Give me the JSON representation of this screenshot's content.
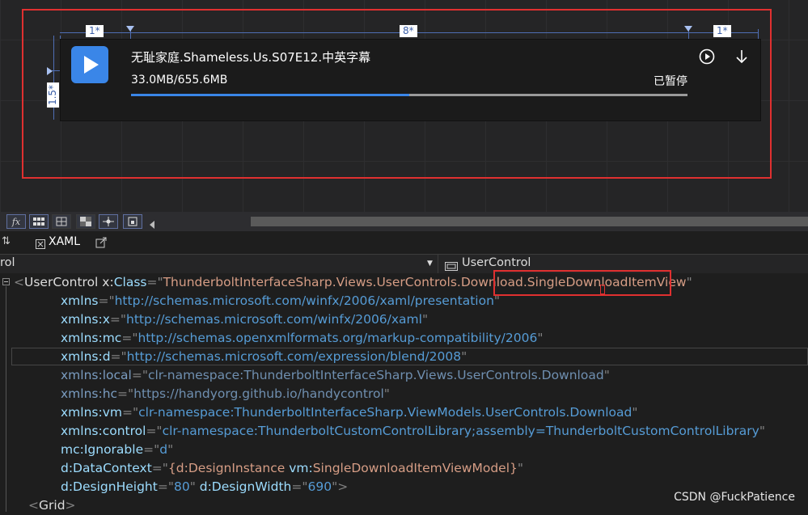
{
  "designer": {
    "col_labels": [
      "1*",
      "8*",
      "1*"
    ],
    "row_label": "1.5*",
    "item": {
      "filename": "无耻家庭.Shameless.Us.S07E12.中英字幕",
      "size": "33.0MB/655.6MB",
      "status": "已暂停",
      "progress": 0.5
    },
    "icons": [
      "play-icon",
      "play-circle-icon",
      "download-arrow-icon"
    ]
  },
  "toolbar": {
    "buttons": [
      "fx",
      "grid",
      "grid-alt",
      "checker",
      "snap",
      "lock"
    ]
  },
  "tabs": {
    "xaml": "XAML"
  },
  "navbar": {
    "left": "rol",
    "right": "UserControl"
  },
  "code": {
    "lines": [
      [
        [
          "<",
          "punct"
        ],
        [
          "UserControl",
          "tag"
        ],
        [
          " x:",
          "attrp"
        ],
        [
          "Class",
          "attr"
        ],
        [
          "=\"",
          "punct"
        ],
        [
          "ThunderboltInterfaceSharp.Views.UserControls.Download.SingleDownloadItemView",
          "val"
        ],
        [
          "\"",
          "punct"
        ]
      ],
      [
        [
          "xmlns",
          "attr"
        ],
        [
          "=\"",
          "punct"
        ],
        [
          "http://schemas.microsoft.com/winfx/2006/xaml/presentation",
          "str"
        ],
        [
          "\"",
          "punct"
        ]
      ],
      [
        [
          "xmlns:x",
          "attr"
        ],
        [
          "=\"",
          "punct"
        ],
        [
          "http://schemas.microsoft.com/winfx/2006/xaml",
          "str"
        ],
        [
          "\"",
          "punct"
        ]
      ],
      [
        [
          "xmlns:mc",
          "attr"
        ],
        [
          "=\"",
          "punct"
        ],
        [
          "http://schemas.openxmlformats.org/markup-compatibility/2006",
          "str"
        ],
        [
          "\"",
          "punct"
        ]
      ],
      [
        [
          "xmlns:d",
          "attr"
        ],
        [
          "=\"",
          "punct"
        ],
        [
          "http://schemas.microsoft.com/expression/blend/2008",
          "str"
        ],
        [
          "\"",
          "punct"
        ]
      ],
      [
        [
          "xmlns:local",
          "dimattr"
        ],
        [
          "=\"",
          "punct"
        ],
        [
          "clr-namespace:ThunderboltInterfaceSharp.Views.UserControls.Download",
          "dim"
        ],
        [
          "\"",
          "punct"
        ]
      ],
      [
        [
          "xmlns:hc",
          "dimattr"
        ],
        [
          "=\"",
          "punct"
        ],
        [
          "https://handyorg.github.io/handycontrol",
          "dim"
        ],
        [
          "\"",
          "punct"
        ]
      ],
      [
        [
          "xmlns:vm",
          "attr"
        ],
        [
          "=\"",
          "punct"
        ],
        [
          "clr-namespace:ThunderboltInterfaceSharp.ViewModels.UserControls.Download",
          "str"
        ],
        [
          "\"",
          "punct"
        ]
      ],
      [
        [
          "xmlns:control",
          "attr"
        ],
        [
          "=\"",
          "punct"
        ],
        [
          "clr-namespace:ThunderboltCustomControlLibrary;assembly=ThunderboltCustomControlLibrary",
          "str"
        ],
        [
          "\"",
          "punct"
        ]
      ],
      [
        [
          "mc:Ignorable",
          "attr"
        ],
        [
          "=\"",
          "punct"
        ],
        [
          "d",
          "str"
        ],
        [
          "\"",
          "punct"
        ]
      ],
      [
        [
          "d:DataContext",
          "attr"
        ],
        [
          "=\"",
          "punct"
        ],
        [
          "{d:DesignInstance ",
          "val"
        ],
        [
          "vm:",
          "attr"
        ],
        [
          "SingleDownloadItemViewModel",
          "val"
        ],
        [
          "}",
          "val"
        ],
        [
          "\"",
          "punct"
        ]
      ],
      [
        [
          "d:DesignHeight",
          "attr"
        ],
        [
          "=\"",
          "punct"
        ],
        [
          "80",
          "str"
        ],
        [
          "\" ",
          "punct"
        ],
        [
          "d:DesignWidth",
          "attr"
        ],
        [
          "=\"",
          "punct"
        ],
        [
          "690",
          "str"
        ],
        [
          "\">",
          "punct"
        ]
      ],
      [
        [
          "<",
          "punct"
        ],
        [
          "Grid",
          "tag"
        ],
        [
          ">",
          "punct"
        ]
      ]
    ]
  },
  "watermark": "CSDN @FuckPatience"
}
